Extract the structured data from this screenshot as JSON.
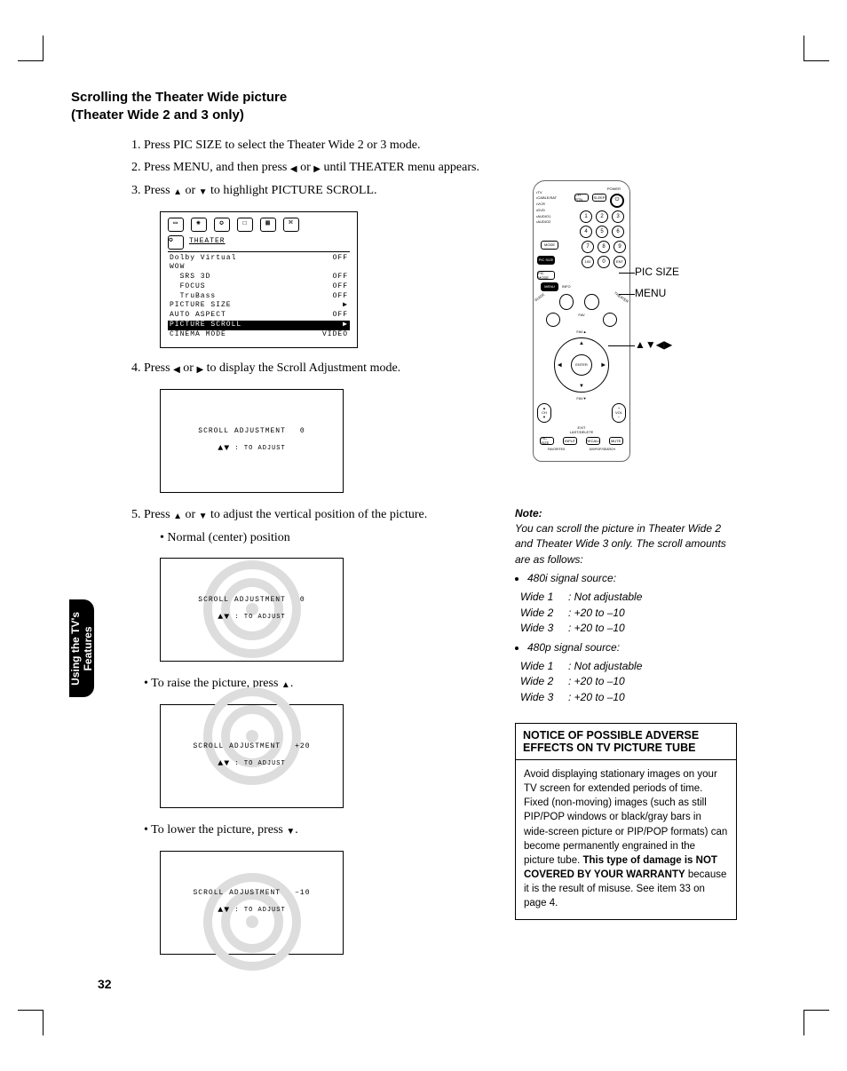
{
  "heading_line1": "Scrolling the Theater Wide picture",
  "heading_line2": "(Theater Wide 2 and 3 only)",
  "steps": {
    "s1": "Press PIC SIZE to select the Theater Wide 2 or 3 mode.",
    "s2a": "Press MENU, and then press ",
    "s2b": " or ",
    "s2c": " until THEATER menu appears.",
    "s3a": "Press ",
    "s3b": " or ",
    "s3c": " to highlight PICTURE SCROLL.",
    "s4a": "Press ",
    "s4b": " or ",
    "s4c": " to display the Scroll Adjustment mode.",
    "s5a": "Press ",
    "s5b": " or ",
    "s5c": " to adjust the vertical position of the picture."
  },
  "bullets": {
    "normal": "Normal (center) position",
    "raise_a": "To raise the picture, press ",
    "raise_b": ".",
    "lower_a": "To lower the picture, press ",
    "lower_b": "."
  },
  "osd_menu": {
    "title": "THEATER",
    "rows": [
      {
        "label": "Dolby Virtual",
        "value": "OFF"
      },
      {
        "label": "WOW",
        "value": ""
      },
      {
        "label": "  SRS 3D",
        "value": "OFF"
      },
      {
        "label": "  FOCUS",
        "value": "OFF"
      },
      {
        "label": "  TruBass",
        "value": "OFF"
      },
      {
        "label": "PICTURE SIZE",
        "value": "▶"
      },
      {
        "label": "AUTO ASPECT",
        "value": "OFF"
      },
      {
        "label": "PICTURE SCROLL",
        "value": "▶"
      },
      {
        "label": "CINEMA MODE",
        "value": "VIDEO"
      }
    ]
  },
  "scroll_box": {
    "label": "SCROLL  ADJUSTMENT",
    "hint": ": TO  ADJUST",
    "v_center": "0",
    "v_raise": "+20",
    "v_lower": "–10"
  },
  "callouts": {
    "picsize": "PIC SIZE",
    "menu": "MENU",
    "arrows": "▲▼◀▶"
  },
  "remote": {
    "power": "POWER",
    "modes": [
      "TV",
      "CABLE/SAT",
      "VCR",
      "DVD",
      "AUDIO1",
      "AUDIO2"
    ],
    "mode_btn": "MODE",
    "top_btns": [
      "CH RTN",
      "SLEEP"
    ],
    "digits": [
      "1",
      "2",
      "3",
      "4",
      "5",
      "6",
      "7",
      "8",
      "9",
      "100",
      "0",
      "ENT"
    ],
    "picsize": "PIC SIZE",
    "picmode": "PIC MODE",
    "menu": "MENU",
    "info": "INFO",
    "enter": "ENTER",
    "guide": "GUIDE",
    "theater": "THEATER",
    "fav": "FAV",
    "fav_up": "FAV▲",
    "fav_down": "FAV▼",
    "ch": "CH",
    "vol": "VOL",
    "exit": "EXIT",
    "last": "LAST/DELETE",
    "bottom": [
      "PIC SIZE",
      "INPUT",
      "RECALL",
      "MUTE"
    ],
    "bottom2": [
      "FAVORITES",
      "100/POP/SEARCH"
    ]
  },
  "note": {
    "hdr": "Note:",
    "body": "You can scroll the picture in Theater Wide 2 and Theater Wide 3 only. The scroll amounts are as follows:",
    "src1": "480i signal source:",
    "src2": "480p signal source:",
    "rows": [
      {
        "k": "Wide 1",
        "v": ":  Not adjustable"
      },
      {
        "k": "Wide 2",
        "v": ":  +20 to –10"
      },
      {
        "k": "Wide 3",
        "v": ":  +20 to –10"
      }
    ]
  },
  "notice": {
    "title": "NOTICE OF POSSIBLE ADVERSE EFFECTS ON TV PICTURE TUBE",
    "body_a": "Avoid displaying stationary images on your TV screen for extended periods of time. Fixed (non-moving) images (such as still PIP/POP windows or black/gray bars in wide-screen picture or PIP/POP formats) can become permanently engrained in the picture tube. ",
    "body_bold": "This type of damage is NOT COVERED BY YOUR WARRANTY",
    "body_b": " because it is the result of misuse. See item 33 on page 4."
  },
  "side_tab_line1": "Using the TV's",
  "side_tab_line2": "Features",
  "page_number": "32"
}
